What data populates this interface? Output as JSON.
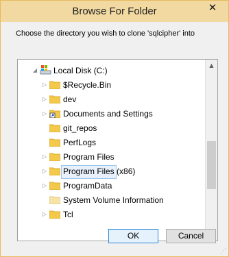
{
  "window": {
    "title": "Browse For Folder",
    "close_label": "✕"
  },
  "prompt": "Choose the directory you wish to clone 'sqlcipher' into",
  "tree": {
    "drive": {
      "label": "Local Disk (C:)",
      "icon": "drive-icon",
      "expanded": true
    },
    "items": [
      {
        "label": "$Recycle.Bin",
        "has_children": true,
        "icon": "folder-icon"
      },
      {
        "label": "dev",
        "has_children": true,
        "icon": "folder-icon"
      },
      {
        "label": "Documents and Settings",
        "has_children": true,
        "icon": "shortcut-folder-icon"
      },
      {
        "label": "git_repos",
        "has_children": false,
        "icon": "folder-icon",
        "selected": true
      },
      {
        "label": "PerfLogs",
        "has_children": false,
        "icon": "folder-icon"
      },
      {
        "label": "Program Files",
        "has_children": true,
        "icon": "folder-icon"
      },
      {
        "label": "Program Files (x86)",
        "has_children": true,
        "icon": "folder-icon"
      },
      {
        "label": "ProgramData",
        "has_children": true,
        "icon": "folder-icon"
      },
      {
        "label": "System Volume Information",
        "has_children": false,
        "icon": "folder-icon"
      },
      {
        "label": "Tcl",
        "has_children": true,
        "icon": "folder-icon"
      }
    ]
  },
  "buttons": {
    "ok": "OK",
    "cancel": "Cancel"
  },
  "colors": {
    "title_bar": "#f1d9a1",
    "border": "#e7b85b",
    "selection": "#e8f1fb",
    "folder": "#f3c94c",
    "ok_border": "#2b87d8"
  }
}
